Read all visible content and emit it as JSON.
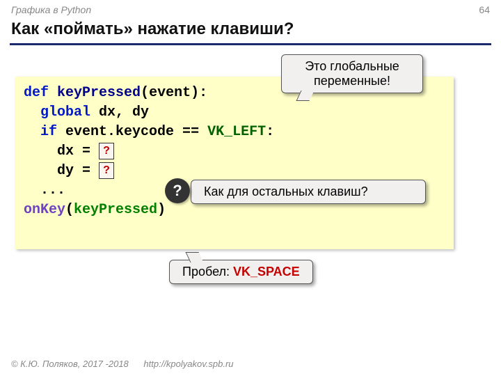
{
  "meta": {
    "breadcrumb": "Графика в Python",
    "page_number": "64",
    "title": "Как «поймать» нажатие клавиши?"
  },
  "code": {
    "kw_def": "def",
    "fn": "keyPressed",
    "paren_args": "(event):",
    "kw_global": "global",
    "global_vars": " dx, dy",
    "kw_if": "if",
    "cond_lhs": " event.keycode == ",
    "const_vkleft": "VK_LEFT",
    "colon": ":",
    "dx_line_prefix": "    dx = ",
    "dy_line_prefix": "    dy = ",
    "q_dx": "?",
    "q_dy": "?",
    "dots": "  ...",
    "onkey": "onKey",
    "onkey_open": "(",
    "onkey_arg": "keyPressed",
    "onkey_close": ")"
  },
  "callouts": {
    "globals_line1": "Это глобальные",
    "globals_line2": "переменные!",
    "qmark": "?",
    "rest_keys": "Как для остальных клавиш?",
    "space_prefix": "Пробел: ",
    "space_const": "VK_SPACE"
  },
  "footer": {
    "copyright": "© К.Ю. Поляков, 2017 -2018",
    "url": "http://kpolyakov.spb.ru"
  }
}
